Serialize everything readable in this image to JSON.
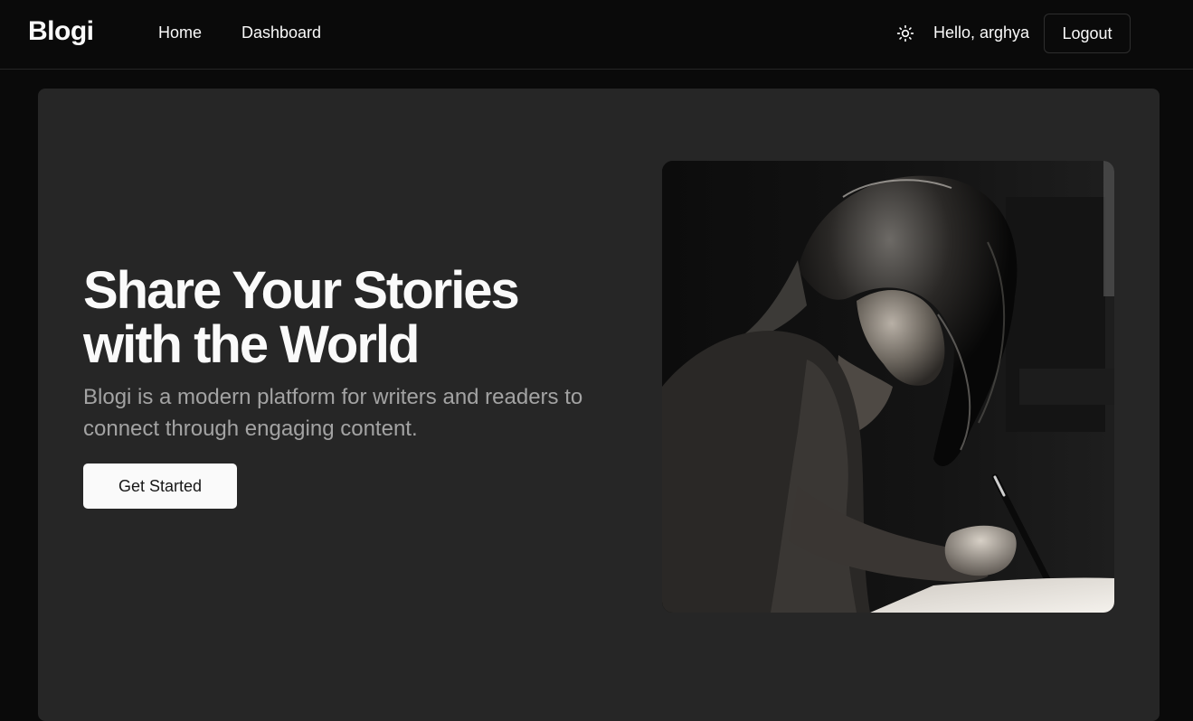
{
  "brand": "Blogi",
  "nav": {
    "home": "Home",
    "dashboard": "Dashboard"
  },
  "user": {
    "greeting": "Hello, arghya",
    "logout": "Logout"
  },
  "theme_toggle_icon": "sun-icon",
  "hero": {
    "title_line1": "Share Your Stories",
    "title_line2": "with the World",
    "subtitle": "Blogi is a modern platform for writers and readers to connect through engaging content.",
    "cta": "Get Started",
    "image_alt": "Woman writing with a pen at a desk"
  },
  "colors": {
    "background": "#0a0a0a",
    "card": "#262626",
    "text": "#fafafa",
    "muted": "#a3a3a3"
  }
}
